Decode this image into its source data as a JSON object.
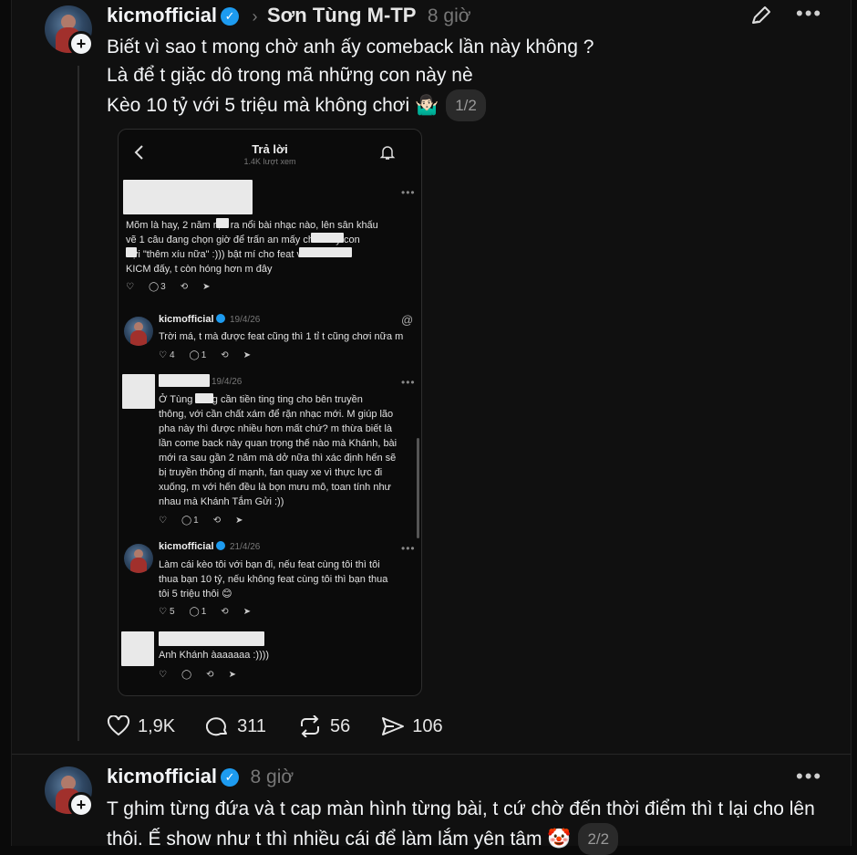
{
  "post1": {
    "username": "kicmofficial",
    "reply_to": "Sơn Tùng M-TP",
    "time": "8 giờ",
    "lines": [
      "Biết vì sao t mong chờ anh ấy comeback lần này không ?",
      "Là để t giặc dô trong mã những con này nè",
      "Kèo 10 tỷ với 5 triệu mà không chơi 🤷🏻‍♂️"
    ],
    "pager": "1/2",
    "likes": "1,9K",
    "comments": "311",
    "reposts": "56",
    "shares": "106"
  },
  "post2": {
    "username": "kicmofficial",
    "time": "8 giờ",
    "text": "T ghim từng đứa và t cap màn hình từng bài, t cứ chờ đến thời điểm thì t lại cho lên thôi. Ế show như t thì nhiều cái để làm lắm yên tâm 🤡",
    "pager": "2/2"
  },
  "shot": {
    "title": "Trả lời",
    "views": "1.4K lượt xem",
    "c1": {
      "lines": [
        "Mõm là hay, 2 năm        rặn ra nổi bài nhạc nào, lên sân khấu",
        "vẽ 1 câu đang chọn giờ để trấn an mấy          cho mấy con",
        "      đợi \"thêm xíu nữa\" :))) bật mí cho                  feat với",
        "KICM đấy, t còn hóng hơn m đây"
      ],
      "comments": "3"
    },
    "r1": {
      "name": "kicmofficial",
      "date": "19/4/26",
      "text": "Trời má, t mà được feat cũng thì 1 tỉ t cũng chơi nữa m",
      "likes": "4",
      "comments": "1"
    },
    "c2": {
      "date": "19/4/26",
      "lines": [
        "Ở Tùng        đang cần tiền ting ting cho bên truyền",
        "thông, với cần chất xám để rặn nhạc mới. M giúp lão",
        "pha này thì được nhiều hơn mất chứ?  m thừa biết là",
        "lần come back này quan trọng thế nào mà Khánh, bài",
        "mới ra sau gần 2 năm mà dở nữa thì xác định hến sẽ",
        "bị truyền thông dí mạnh, fan quay xe vì thực lực đi",
        "xuống, m với hến đều là bọn mưu mô, toan tính như",
        "nhau mà Khánh Tắm Gửi :))"
      ],
      "comments": "1"
    },
    "r2": {
      "name": "kicmofficial",
      "date": "21/4/26",
      "lines": [
        "Làm cái kèo tôi với bạn đi, nếu feat cùng tôi thì tôi",
        "thua bạn 10 tỷ, nếu không feat cùng tôi thì bạn thua",
        "tôi 5 triệu thôi 😊"
      ],
      "likes": "5",
      "comments": "1"
    },
    "c3": {
      "text": "Anh Khánh àaaaaaa :))))"
    }
  },
  "colors": {
    "verified": "#1d9bf0",
    "background": "#101010"
  }
}
